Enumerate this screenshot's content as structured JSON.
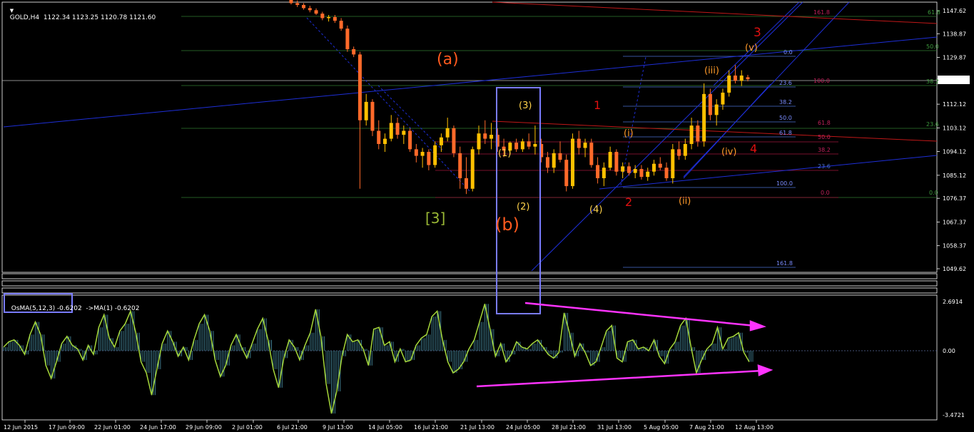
{
  "header": {
    "symbol": "GOLD,H4",
    "ohlc": "1122.34 1123.25 1120.78 1121.60"
  },
  "indicator": {
    "label": "OsMA(5,12,3) -0.6202",
    "ma_label": "->MA(1) -0.6202",
    "axis_ticks": [
      "2.6914",
      "0.00",
      "-3.4721"
    ]
  },
  "colors": {
    "background": "#000000",
    "bull_candle": "#ffc000",
    "bear_candle": "#ff6a2a",
    "osma_line": "#a6d83a",
    "osma_bars": "#3f7a8c",
    "trendline_blue": "#1e2fd8",
    "trendline_red": "#c01818",
    "highlight_box": "#7a7cff",
    "divergence_arrow": "#ff33ff"
  },
  "chart_data": {
    "type": "candlestick",
    "symbol": "GOLD",
    "timeframe": "H4",
    "price_axis_ticks": [
      "1147.62",
      "1138.87",
      "1129.87",
      "1121.60",
      "1112.12",
      "1103.12",
      "1094.12",
      "1085.12",
      "1076.37",
      "1067.37",
      "1058.37",
      "1049.62"
    ],
    "current_price": "1121.60",
    "ylim": [
      1049.62,
      1153
    ],
    "time_axis_labels": [
      "12 Jun 2015",
      "17 Jun 09:00",
      "22 Jun 01:00",
      "24 Jun 17:00",
      "29 Jun 09:00",
      "2 Jul 01:00",
      "6 Jul 21:00",
      "9 Jul 13:00",
      "14 Jul 05:00",
      "16 Jul 21:00",
      "21 Jul 13:00",
      "24 Jul 05:00",
      "28 Jul 21:00",
      "31 Jul 13:00",
      "5 Aug 05:00",
      "7 Aug 21:00",
      "12 Aug 13:00"
    ],
    "wave_labels": {
      "red_large": [
        "(a)",
        "(b)"
      ],
      "green_large": [
        "[3]"
      ],
      "yellow": [
        "(1)",
        "(2)",
        "(3)",
        "(4)"
      ],
      "red_small": [
        "1",
        "2",
        "3",
        "4"
      ],
      "orange": [
        "(i)",
        "(ii)",
        "(iii)",
        "(iv)",
        "(v)"
      ]
    },
    "fib_green_levels": [
      "61.8",
      "50.0",
      "38.2",
      "23.6",
      "0.0"
    ],
    "fib_red_levels": [
      "61.8",
      "50.0",
      "38.2",
      "23.6",
      "0.0"
    ],
    "fib_purple_levels": [
      "161.8",
      "100.0"
    ],
    "fib_blue_levels": [
      "0.0",
      "23.6",
      "38.2",
      "50.0",
      "61.8",
      "100.0",
      "161.8"
    ],
    "candles": [
      {
        "o": 1152.0,
        "h": 1153.0,
        "l": 1150.0,
        "c": 1150.5
      },
      {
        "o": 1150.5,
        "h": 1151.5,
        "l": 1149.0,
        "c": 1149.8
      },
      {
        "o": 1149.8,
        "h": 1150.5,
        "l": 1148.0,
        "c": 1148.6
      },
      {
        "o": 1148.6,
        "h": 1149.5,
        "l": 1147.0,
        "c": 1147.8
      },
      {
        "o": 1147.8,
        "h": 1148.5,
        "l": 1146.0,
        "c": 1146.5
      },
      {
        "o": 1146.5,
        "h": 1147.2,
        "l": 1144.0,
        "c": 1144.8
      },
      {
        "o": 1144.8,
        "h": 1146.0,
        "l": 1143.5,
        "c": 1145.2
      },
      {
        "o": 1145.2,
        "h": 1146.0,
        "l": 1143.0,
        "c": 1143.8
      },
      {
        "o": 1143.8,
        "h": 1144.8,
        "l": 1140.0,
        "c": 1140.8
      },
      {
        "o": 1140.8,
        "h": 1142.0,
        "l": 1132.0,
        "c": 1133.0
      },
      {
        "o": 1133.0,
        "h": 1134.0,
        "l": 1130.0,
        "c": 1131.0
      },
      {
        "o": 1131.0,
        "h": 1132.0,
        "l": 1080.0,
        "c": 1106.0
      },
      {
        "o": 1106.0,
        "h": 1116.0,
        "l": 1104.0,
        "c": 1113.0
      },
      {
        "o": 1113.0,
        "h": 1114.0,
        "l": 1100.0,
        "c": 1102.0
      },
      {
        "o": 1102.0,
        "h": 1106.0,
        "l": 1095.0,
        "c": 1097.0
      },
      {
        "o": 1097.0,
        "h": 1101.0,
        "l": 1094.0,
        "c": 1099.0
      },
      {
        "o": 1099.0,
        "h": 1108.0,
        "l": 1098.0,
        "c": 1105.0
      },
      {
        "o": 1105.0,
        "h": 1107.0,
        "l": 1099.0,
        "c": 1100.5
      },
      {
        "o": 1100.5,
        "h": 1104.0,
        "l": 1097.0,
        "c": 1102.0
      },
      {
        "o": 1102.0,
        "h": 1103.0,
        "l": 1094.0,
        "c": 1095.0
      },
      {
        "o": 1095.0,
        "h": 1097.0,
        "l": 1090.0,
        "c": 1092.5
      },
      {
        "o": 1092.5,
        "h": 1095.5,
        "l": 1088.0,
        "c": 1094.0
      },
      {
        "o": 1094.0,
        "h": 1095.0,
        "l": 1087.0,
        "c": 1089.0
      },
      {
        "o": 1089.0,
        "h": 1098.0,
        "l": 1088.0,
        "c": 1096.5
      },
      {
        "o": 1096.5,
        "h": 1101.0,
        "l": 1094.0,
        "c": 1099.5
      },
      {
        "o": 1099.5,
        "h": 1107.0,
        "l": 1098.0,
        "c": 1103.0
      },
      {
        "o": 1103.0,
        "h": 1104.0,
        "l": 1092.0,
        "c": 1093.5
      },
      {
        "o": 1093.5,
        "h": 1096.0,
        "l": 1080.0,
        "c": 1084.0
      },
      {
        "o": 1084.0,
        "h": 1092.0,
        "l": 1078.0,
        "c": 1080.0
      },
      {
        "o": 1080.0,
        "h": 1096.0,
        "l": 1079.0,
        "c": 1095.0
      },
      {
        "o": 1095.0,
        "h": 1104.0,
        "l": 1093.0,
        "c": 1101.0
      },
      {
        "o": 1101.0,
        "h": 1106.0,
        "l": 1097.0,
        "c": 1099.0
      },
      {
        "o": 1099.0,
        "h": 1105.0,
        "l": 1095.0,
        "c": 1100.5
      },
      {
        "o": 1100.5,
        "h": 1103.0,
        "l": 1094.0,
        "c": 1096.0
      },
      {
        "o": 1096.0,
        "h": 1099.0,
        "l": 1092.0,
        "c": 1094.5
      },
      {
        "o": 1094.5,
        "h": 1098.0,
        "l": 1093.0,
        "c": 1097.5
      },
      {
        "o": 1097.5,
        "h": 1099.0,
        "l": 1094.0,
        "c": 1095.0
      },
      {
        "o": 1095.0,
        "h": 1099.0,
        "l": 1094.0,
        "c": 1098.0
      },
      {
        "o": 1098.0,
        "h": 1101.0,
        "l": 1095.0,
        "c": 1096.0
      },
      {
        "o": 1096.0,
        "h": 1104.0,
        "l": 1093.0,
        "c": 1097.0
      },
      {
        "o": 1097.0,
        "h": 1099.0,
        "l": 1090.0,
        "c": 1092.0
      },
      {
        "o": 1092.0,
        "h": 1094.0,
        "l": 1086.0,
        "c": 1088.0
      },
      {
        "o": 1088.0,
        "h": 1095.0,
        "l": 1086.0,
        "c": 1093.5
      },
      {
        "o": 1093.5,
        "h": 1098.0,
        "l": 1090.0,
        "c": 1091.0
      },
      {
        "o": 1091.0,
        "h": 1093.0,
        "l": 1079.0,
        "c": 1081.0
      },
      {
        "o": 1081.0,
        "h": 1101.0,
        "l": 1080.0,
        "c": 1099.0
      },
      {
        "o": 1099.0,
        "h": 1102.0,
        "l": 1093.0,
        "c": 1095.5
      },
      {
        "o": 1095.5,
        "h": 1099.0,
        "l": 1092.0,
        "c": 1097.5
      },
      {
        "o": 1097.5,
        "h": 1099.0,
        "l": 1088.0,
        "c": 1089.0
      },
      {
        "o": 1089.0,
        "h": 1092.0,
        "l": 1082.0,
        "c": 1084.0
      },
      {
        "o": 1084.0,
        "h": 1090.0,
        "l": 1081.0,
        "c": 1088.0
      },
      {
        "o": 1088.0,
        "h": 1096.0,
        "l": 1087.0,
        "c": 1094.0
      },
      {
        "o": 1094.0,
        "h": 1095.0,
        "l": 1085.0,
        "c": 1086.5
      },
      {
        "o": 1086.5,
        "h": 1090.0,
        "l": 1084.0,
        "c": 1088.5
      },
      {
        "o": 1088.5,
        "h": 1090.0,
        "l": 1085.0,
        "c": 1086.0
      },
      {
        "o": 1086.0,
        "h": 1089.0,
        "l": 1084.0,
        "c": 1087.5
      },
      {
        "o": 1087.5,
        "h": 1089.0,
        "l": 1083.5,
        "c": 1084.5
      },
      {
        "o": 1084.5,
        "h": 1088.0,
        "l": 1083.0,
        "c": 1086.5
      },
      {
        "o": 1086.5,
        "h": 1091.0,
        "l": 1085.0,
        "c": 1089.5
      },
      {
        "o": 1089.5,
        "h": 1092.0,
        "l": 1087.0,
        "c": 1088.0
      },
      {
        "o": 1088.0,
        "h": 1090.0,
        "l": 1083.0,
        "c": 1084.0
      },
      {
        "o": 1084.0,
        "h": 1097.0,
        "l": 1082.0,
        "c": 1095.0
      },
      {
        "o": 1095.0,
        "h": 1098.0,
        "l": 1091.0,
        "c": 1092.5
      },
      {
        "o": 1092.5,
        "h": 1099.0,
        "l": 1091.0,
        "c": 1097.0
      },
      {
        "o": 1097.0,
        "h": 1107.0,
        "l": 1095.0,
        "c": 1104.0
      },
      {
        "o": 1104.0,
        "h": 1106.0,
        "l": 1096.0,
        "c": 1098.0
      },
      {
        "o": 1098.0,
        "h": 1120.0,
        "l": 1096.0,
        "c": 1116.0
      },
      {
        "o": 1116.0,
        "h": 1118.0,
        "l": 1106.0,
        "c": 1108.0
      },
      {
        "o": 1108.0,
        "h": 1114.0,
        "l": 1104.0,
        "c": 1112.0
      },
      {
        "o": 1112.0,
        "h": 1118.0,
        "l": 1110.0,
        "c": 1116.5
      },
      {
        "o": 1116.5,
        "h": 1125.0,
        "l": 1115.0,
        "c": 1123.0
      },
      {
        "o": 1123.0,
        "h": 1127.0,
        "l": 1120.0,
        "c": 1121.0
      },
      {
        "o": 1121.0,
        "h": 1125.0,
        "l": 1119.0,
        "c": 1123.0
      },
      {
        "o": 1122.34,
        "h": 1123.25,
        "l": 1120.78,
        "c": 1121.6
      }
    ],
    "osma": [
      0.2,
      0.5,
      0.6,
      0.3,
      -0.2,
      0.9,
      1.6,
      0.9,
      -0.8,
      -1.5,
      -0.6,
      0.4,
      0.8,
      0.3,
      0.1,
      -0.5,
      0.3,
      -0.2,
      1.3,
      2.0,
      0.7,
      0.2,
      1.1,
      1.5,
      2.2,
      1.0,
      -0.6,
      -1.2,
      -2.4,
      -1.0,
      0.4,
      1.1,
      0.5,
      -0.3,
      0.2,
      -0.5,
      0.6,
      1.5,
      2.0,
      1.1,
      -0.5,
      -1.4,
      -0.8,
      0.3,
      0.9,
      0.2,
      -0.4,
      0.4,
      1.2,
      1.8,
      0.6,
      -1.0,
      -2.0,
      -0.4,
      0.6,
      0.2,
      -0.5,
      0.3,
      1.0,
      2.3,
      0.8,
      -1.8,
      -3.4,
      -2.2,
      -0.3,
      0.9,
      0.5,
      0.6,
      0.1,
      -0.8,
      1.2,
      1.3,
      0.3,
      0.5,
      -0.6,
      0.1,
      -0.6,
      -0.5,
      0.3,
      0.7,
      0.9,
      1.9,
      2.2,
      0.6,
      -0.6,
      -1.2,
      -1.0,
      -0.6,
      0.1,
      0.6,
      1.6,
      2.6,
      1.2,
      -0.3,
      0.4,
      -0.6,
      -0.2,
      0.5,
      0.2,
      0.1,
      0.4,
      0.6,
      0.2,
      -0.2,
      -0.4,
      -0.1,
      2.1,
      1.0,
      -0.3,
      0.4,
      -0.1,
      -0.8,
      -0.6,
      0.2,
      1.1,
      1.4,
      -0.4,
      -0.6,
      0.5,
      0.6,
      0.1,
      0.2,
      0.0,
      0.6,
      -0.3,
      -0.7,
      0.1,
      0.5,
      1.4,
      1.8,
      0.2,
      -1.2,
      -0.5,
      0.1,
      0.4,
      1.3,
      0.1,
      0.7,
      0.8,
      1.0,
      -0.1,
      -0.6
    ],
    "osma_ylim": [
      -3.4721,
      2.6914
    ]
  }
}
